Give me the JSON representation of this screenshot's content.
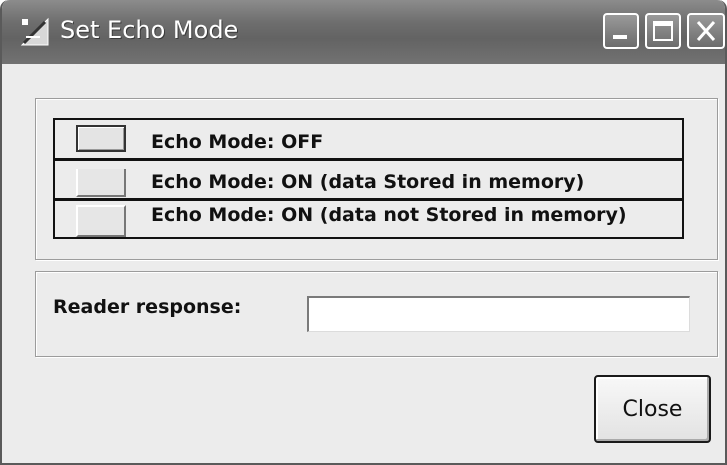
{
  "window": {
    "title": "Set Echo Mode"
  },
  "titlebar_buttons": {
    "minimize_icon": "minimize-icon",
    "maximize_icon": "maximize-icon",
    "close_icon": "close-icon"
  },
  "echo_options": [
    {
      "label": "Echo Mode: OFF"
    },
    {
      "label": "Echo Mode: ON (data Stored in memory)"
    },
    {
      "label": "Echo Mode: ON (data not Stored in memory)"
    }
  ],
  "reader": {
    "label": "Reader response:",
    "value": ""
  },
  "footer": {
    "close_label": "Close"
  },
  "colors": {
    "titlebar": "#6e6e6e",
    "window_bg": "#ececec",
    "title_text": "#ffffff"
  }
}
